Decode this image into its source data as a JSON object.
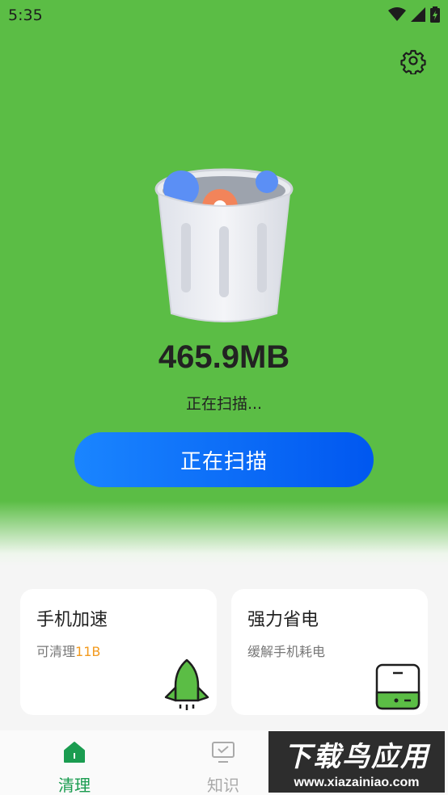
{
  "status_bar": {
    "time": "5:35",
    "icons": [
      "wifi-icon",
      "signal-icon",
      "battery-charging-icon"
    ]
  },
  "header": {
    "settings_icon": "gear-icon"
  },
  "scan": {
    "size": "465.9MB",
    "status": "正在扫描...",
    "button_label": "正在扫描"
  },
  "cards": [
    {
      "title": "手机加速",
      "subtitle_prefix": "可清理",
      "subtitle_highlight": "11B",
      "icon": "rocket-icon"
    },
    {
      "title": "强力省电",
      "subtitle": "缓解手机耗电",
      "icon": "battery-pack-icon"
    }
  ],
  "tabs": [
    {
      "label": "清理",
      "icon": "home-icon",
      "active": true
    },
    {
      "label": "知识",
      "icon": "monitor-check-icon",
      "active": false
    }
  ],
  "watermark": {
    "main": "下载鸟应用",
    "url": "www.xiazainiao.com"
  },
  "colors": {
    "primary_green": "#5bbd45",
    "button_blue": "#1a85ff",
    "highlight_orange": "#f39a1e",
    "tab_active": "#1a9c50"
  }
}
